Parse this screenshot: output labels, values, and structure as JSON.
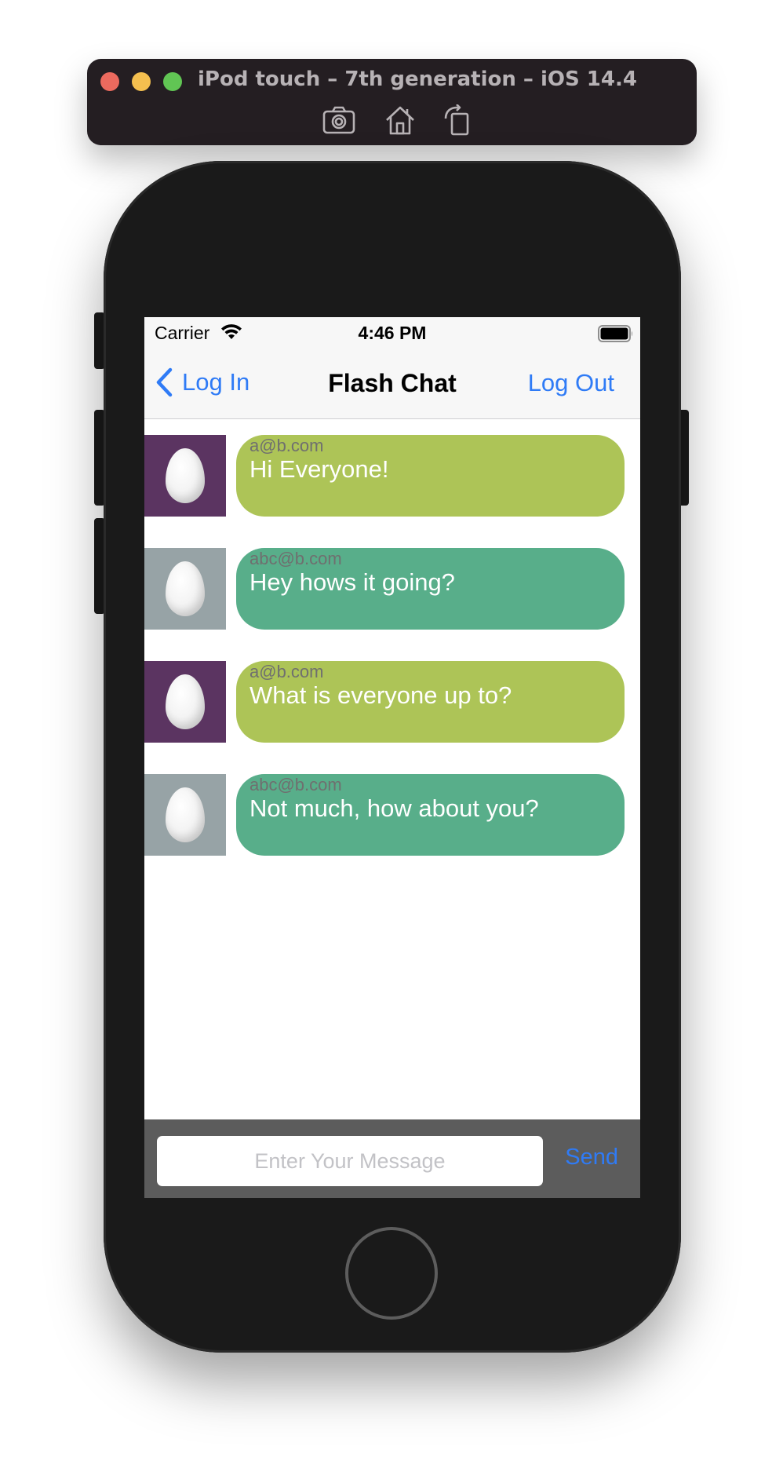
{
  "simulator": {
    "title": "iPod touch – 7th generation – iOS 14.4",
    "tools": [
      "screenshot-icon",
      "home-icon",
      "rotate-icon"
    ]
  },
  "status_bar": {
    "carrier": "Carrier",
    "time": "4:46 PM"
  },
  "nav": {
    "back_label": "Log In",
    "title": "Flash Chat",
    "right_label": "Log Out"
  },
  "messages": [
    {
      "sender": "a@b.com",
      "text": "Hi Everyone!",
      "avatar_color": "#5b3461",
      "bubble_color": "#adc457"
    },
    {
      "sender": "abc@b.com",
      "text": "Hey hows it going?",
      "avatar_color": "#97a3a6",
      "bubble_color": "#58ae8a"
    },
    {
      "sender": "a@b.com",
      "text": "What is everyone up to?",
      "avatar_color": "#5b3461",
      "bubble_color": "#adc457"
    },
    {
      "sender": "abc@b.com",
      "text": "Not much, how about you?",
      "avatar_color": "#97a3a6",
      "bubble_color": "#58ae8a"
    }
  ],
  "compose": {
    "placeholder": "Enter Your Message",
    "value": "",
    "send_label": "Send"
  },
  "colors": {
    "accent": "#2f7bf6",
    "compose_bar": "#5c5c5c",
    "device_body": "#1a1a1a"
  }
}
